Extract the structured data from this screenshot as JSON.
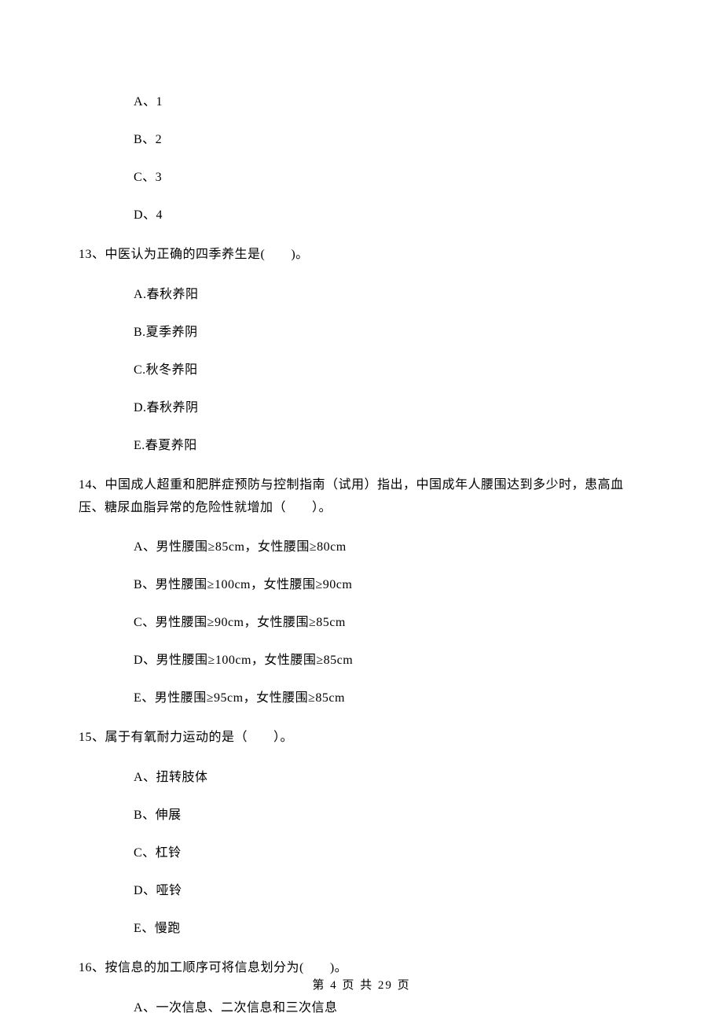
{
  "q12_options": {
    "a": "A、1",
    "b": "B、2",
    "c": "C、3",
    "d": "D、4"
  },
  "q13": {
    "text": "13、中医认为正确的四季养生是(　　)。",
    "options": {
      "a": "A.春秋养阳",
      "b": "B.夏季养阴",
      "c": "C.秋冬养阳",
      "d": "D.春秋养阴",
      "e": "E.春夏养阳"
    }
  },
  "q14": {
    "text": "14、中国成人超重和肥胖症预防与控制指南（试用）指出，中国成年人腰围达到多少时，患高血压、糖尿血脂异常的危险性就增加（　　）。",
    "options": {
      "a": "A、男性腰围≥85cm，女性腰围≥80cm",
      "b": "B、男性腰围≥100cm，女性腰围≥90cm",
      "c": "C、男性腰围≥90cm，女性腰围≥85cm",
      "d": "D、男性腰围≥100cm，女性腰围≥85cm",
      "e": "E、男性腰围≥95cm，女性腰围≥85cm"
    }
  },
  "q15": {
    "text": "15、属于有氧耐力运动的是（　　）。",
    "options": {
      "a": "A、扭转肢体",
      "b": "B、伸展",
      "c": "C、杠铃",
      "d": "D、哑铃",
      "e": "E、慢跑"
    }
  },
  "q16": {
    "text": "16、按信息的加工顺序可将信息划分为(　　)。",
    "options": {
      "a": "A、一次信息、二次信息和三次信息"
    }
  },
  "footer": "第 4 页 共 29 页"
}
